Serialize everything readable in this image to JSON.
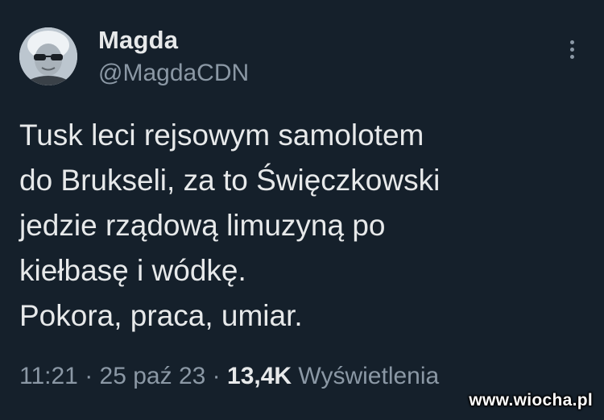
{
  "author": {
    "display_name": "Magda",
    "handle": "@MagdaCDN",
    "avatar_icon": "avatar-photo"
  },
  "tweet": {
    "lines": [
      "Tusk leci rejsowym samolotem",
      "do Brukseli, za to Święczkowski",
      "jedzie rządową limuzyną po",
      "kiełbasę i wódkę.",
      "Pokora, praca, umiar."
    ]
  },
  "meta": {
    "time": "11:21",
    "separator": "·",
    "date": "25 paź 23",
    "views_count": "13,4K",
    "views_label": "Wyświetlenia"
  },
  "watermark": "www.wiocha.pl",
  "colors": {
    "background": "#15202b",
    "primary_text": "#e7e9ea",
    "secondary_text": "#8b98a5"
  },
  "icons": {
    "more": "more-vertical-icon"
  }
}
